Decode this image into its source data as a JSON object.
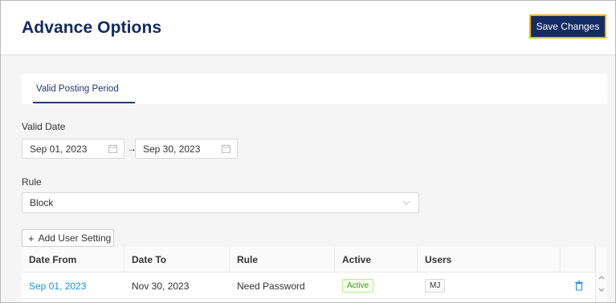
{
  "header": {
    "title": "Advance Options",
    "save_label": "Save Changes"
  },
  "tabs": [
    {
      "label": "Valid Posting Period",
      "active": true
    }
  ],
  "valid_date": {
    "label": "Valid Date",
    "from": "Sep 01, 2023",
    "to": "Sep 30, 2023",
    "separator": "→"
  },
  "rule": {
    "label": "Rule",
    "value": "Block"
  },
  "add_user_setting": {
    "plus": "+",
    "label": "Add User Setting"
  },
  "table": {
    "columns": [
      "Date From",
      "Date To",
      "Rule",
      "Active",
      "Users"
    ],
    "rows": [
      {
        "date_from": "Sep 01, 2023",
        "date_to": "Nov 30, 2023",
        "rule": "Need Password",
        "active": "Active",
        "users": "MJ"
      }
    ]
  },
  "colors": {
    "brand": "#142b63",
    "accent_border": "#f5b400",
    "link": "#1f8fd6",
    "active_green": "#389e0d"
  },
  "icons": [
    "calendar-icon",
    "chevron-down-icon",
    "plus-icon",
    "trash-icon",
    "scroll-up-icon",
    "scroll-down-icon"
  ]
}
